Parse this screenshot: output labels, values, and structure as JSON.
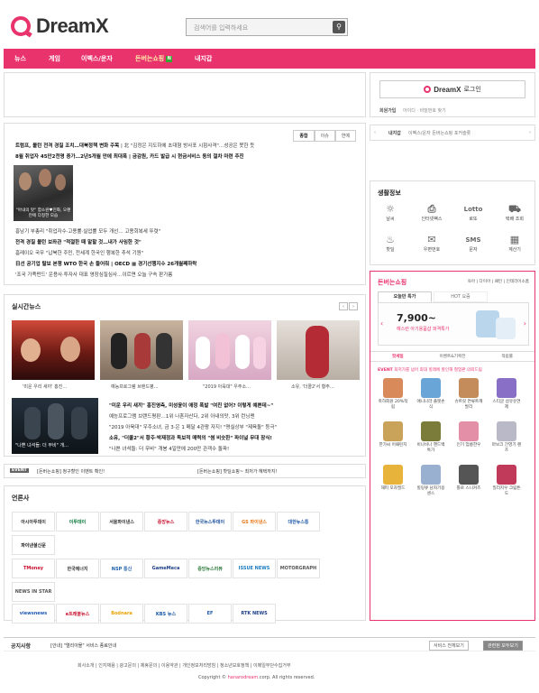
{
  "header": {
    "logo_text": "DreamX",
    "search_placeholder": "검색어를 입력하세요"
  },
  "gnb": [
    {
      "label": "뉴스"
    },
    {
      "label": "게임"
    },
    {
      "label": "이벡스/운자"
    },
    {
      "label": "돈버는쇼핑",
      "new": "N",
      "active": true
    },
    {
      "label": "내지갑"
    }
  ],
  "login": {
    "button_logo": "DreamX",
    "button_label": "로그인",
    "signup": "회원가입",
    "find": "아이디 · 비밀번호 찾기"
  },
  "quick_links": {
    "title": "내지갑",
    "text": "이벡스/운자  돈버는쇼핑  포커슬롯"
  },
  "news": {
    "tabs": [
      "종합",
      "이슈",
      "연예"
    ],
    "headlines": [
      {
        "bold": "트럼프, 볼턴 전격 경질 조치…대북정책 변화 주목",
        "rest": " | 北 \"김정은 지도하에 초대형 방사포 시험사격\"…성공은 못한 듯"
      },
      {
        "bold": "8월 취업자 45만2천명 증가…2년5개월 만에 최대폭",
        "rest": " | 금감원, 카드 발급 시 현금서비스 동의 절차 마련 추진"
      }
    ],
    "photo_caption": "\"아내의 맛\" 함소원♥진화, 오랜만에 다정한 모습",
    "list": [
      "흥남기 부총리 \"취업자수·고용률·실업률 모두 개선… 고용회복세 뚜렷\"",
      "전격 경질 볼턴 보좌관 \"적절한 때 말할 것…내가 사임한 것\"",
      "흠레이오 국무 \"납북한 주민, 전세계 한국인 행복한 추석 기원\"",
      "日선 공기업 탈보 본쟁 WTO 한국 손 들어줘 | OECD ▦ 경기선행지수 26개월째하락",
      "'조국 가족펀드' 운용사·투자사 대표 영장심질심사…이르면 오늘 구속 판가름"
    ]
  },
  "realtime": {
    "title": "실시간뉴스",
    "captions": [
      "'미운 우리 새끼' 홍진…",
      "예능프로그램 브랜드평…",
      "\"2019 아육대\" 우주소…",
      "소유, '더콜2'서 황주…"
    ],
    "sub_caption": "\"나쁜 녀석들: 더 무비\" 개…",
    "lines": [
      "\"미운 우리 새끼\" 홍진영측, 미성윤이 애정 폭발 \"여친 없어? 이렇게 예쁜데~\"",
      "예능프로그램 브랜드평판…1위 나혼자산다, 2위 아내의맛, 3위 런닝맨",
      "\"2019 아육대\" 우주소녀, 금 3·은 1 메달 4관왕 자지! \"명실상부 \"제육돌\" 등극\"",
      "소유, \"더콜2\"서 황주·박재정과 독보적 매력의 \"썸 비숫한\" 파이널 무대 장식!",
      "\"나쁜 녀석들: 더 무비\" 개봉 4일만에 200만 관객수 돌파!"
    ]
  },
  "event": {
    "badge": "EVENT",
    "left": "[돈버는쇼핑] 청구할인 이벤트 확인!",
    "right": "[돈버는쇼핑] 핫딜쇼핑~ 최저가 혜택까지!"
  },
  "press": {
    "title": "언론사",
    "logos": [
      "아시아투데이",
      "이투데이",
      "서울파이낸스",
      "중앙뉴스",
      "한국뉴스투데이",
      "GS 파이낸스",
      "대한뉴스통",
      "파이낸셜신문",
      "TMoney",
      "한국에너지",
      "NSP 통신",
      "GameMeca",
      "중앙뉴스리뷰",
      "ISSUE NEWS",
      "MOTORGRAPH",
      "NEWS IN STAR",
      "viewsnews",
      "e트래블뉴스",
      "Bodnara",
      "KBS 뉴스",
      "EF",
      "RTK NEWS"
    ]
  },
  "life": {
    "title": "생활정보",
    "items": [
      {
        "label": "날씨",
        "icon": "sun-icon"
      },
      {
        "label": "인터넷팩스",
        "icon": "fax-icon"
      },
      {
        "label": "로또",
        "icon": "lotto-icon",
        "mark": "Lotto"
      },
      {
        "label": "택배 조회",
        "icon": "truck-icon"
      },
      {
        "label": "핫딜",
        "icon": "gift-icon"
      },
      {
        "label": "우편번호",
        "icon": "mail-icon"
      },
      {
        "label": "문자",
        "icon": "sms-icon",
        "mark": "SMS"
      },
      {
        "label": "계산기",
        "icon": "calculator-icon"
      }
    ]
  },
  "shop": {
    "title": "돈버는쇼핑",
    "top_links": "육아 | 다이아 | 패턴 | 인테리어소품",
    "tabs": [
      "오늘만 특가",
      "HOT 요즘"
    ],
    "banner_price": "7,900~",
    "banner_text": "예스런 아기용품샵 파격특가",
    "categories": [
      "핫세일",
      "이벤트&기획전",
      "적립률"
    ],
    "event_badge": "EVENT",
    "event_text": "최저가를 넘어 최대 힐레에 할인해 철업판 의뢰드림",
    "items": [
      {
        "label": "축하회원 20%적립",
        "color": "#d98a5b"
      },
      {
        "label": "애니나라 플렛손식",
        "color": "#6aa5d8"
      },
      {
        "label": "슈트릿 면류트캐발리",
        "color": "#c38c5a"
      },
      {
        "label": "스티글 섬유유연제",
        "color": "#8a6fc7"
      },
      {
        "label": "한가씨 어패린지",
        "color": "#c9a35a"
      },
      {
        "label": "비나비나 핸드백 특가",
        "color": "#7b7b3a"
      },
      {
        "label": "인기 엄룸한우",
        "color": "#e48fa8"
      },
      {
        "label": "마보크 간영기 랜즈",
        "color": "#b9b9c7"
      },
      {
        "label": "해피 모자필드",
        "color": "#e8b33a"
      },
      {
        "label": "힐링큐 남자기용센스",
        "color": "#9ab0d0"
      },
      {
        "label": "톨로 스니커즈",
        "color": "#555555"
      },
      {
        "label": "밀리지우 크림튼도",
        "color": "#c23a5a"
      }
    ]
  },
  "notice": {
    "title": "공지사항",
    "text": "[안내] \"엘리아몰\" 서비스 종료안내",
    "select1": "서비스 전체보기",
    "select2": "관련된 모두보기"
  },
  "footer": {
    "links": "회사소개 | 인지채용 | 광고문의 | 제휴문의 | 이용약관 | 개인정보처리방침 | 청소년보호정책 | 이메일무단수집거부",
    "copyright_prefix": "Copyright © ",
    "copyright_domain": "hanarodream",
    "copyright_suffix": ".corp. All rights reserved."
  },
  "colors": {
    "accent": "#e8336d"
  }
}
